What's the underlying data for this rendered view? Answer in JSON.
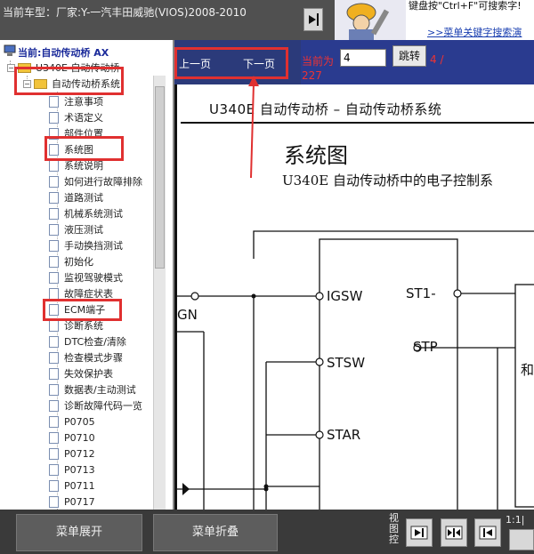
{
  "topbar": {
    "vehicle_text": "当前车型：厂家:Y-一汽丰田威驰(VIOS)2008-2010",
    "tip_text": "键盘按\"Ctrl+F\"可搜索字!",
    "tip_link": ">>菜单关键字搜索演",
    "buttons": [
      "next-page-icon",
      "prev-page-icon"
    ]
  },
  "tree": {
    "current_label": "当前:自动传动桥 AX",
    "root": "U340E 自动传动桥",
    "folder": "自动传动桥系统",
    "items": [
      "注意事项",
      "术语定义",
      "部件位置",
      "系统图",
      "系统说明",
      "如何进行故障排除",
      "道路测试",
      "机械系统测试",
      "液压测试",
      "手动换挡测试",
      "初始化",
      "监视驾驶模式",
      "故障症状表",
      "ECM端子",
      "诊断系统",
      "DTC检查/清除",
      "检查模式步骤",
      "失效保护表",
      "数据表/主动测试",
      "诊断故障代码一览",
      "P0705",
      "P0710",
      "P0712",
      "P0713",
      "P0711",
      "P0717"
    ]
  },
  "pager": {
    "prev": "上一页",
    "next": "下一页",
    "current_label": "当前为",
    "page_value": "4",
    "jump": "跳转",
    "page_count": "4 /",
    "page_total": "227"
  },
  "doc": {
    "header": "U340E  自动传动桥 –  自动传动桥系统",
    "title": "系统图",
    "subtitle": "U340E 自动传动桥中的电子控制系",
    "pins": [
      "IGSW",
      "STSW",
      "STAR",
      "ST1-",
      "STP",
      "GN",
      "和"
    ]
  },
  "bottom": {
    "expand": "菜单展开",
    "collapse": "菜单折叠",
    "view_control": "视图控",
    "zoom": "1:1|"
  },
  "colors": {
    "highlight": "#e03030",
    "nav_blue": "#2a3b8f",
    "pager_red": "#e33333"
  }
}
